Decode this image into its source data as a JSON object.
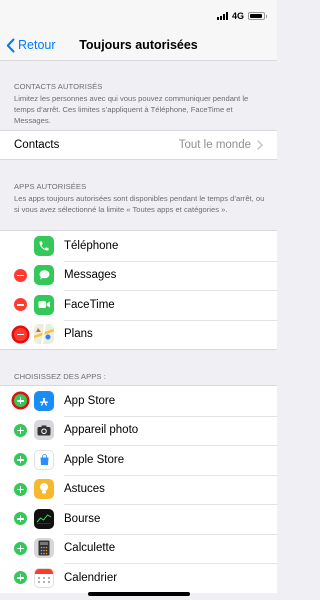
{
  "status_bar": {
    "network": "4G"
  },
  "nav": {
    "back_label": "Retour",
    "title": "Toujours autorisées"
  },
  "contacts_section": {
    "header": "CONTACTS AUTORISÉS",
    "description": "Limitez les personnes avec qui vous pouvez communiquer pendant le temps d’arrêt. Ces limites s’appliquent à Téléphone, FaceTime et Messages.",
    "row_label": "Contacts",
    "row_value": "Tout le monde"
  },
  "allowed_apps_section": {
    "header": "APPS AUTORISÉES",
    "description": "Les apps toujours autorisées sont disponibles pendant le temps d’arrêt, ou si vous avez sélectionné la limite « Toutes apps et catégories ».",
    "apps": [
      {
        "name": "Téléphone",
        "icon": "phone-icon",
        "removable": false
      },
      {
        "name": "Messages",
        "icon": "messages-icon",
        "removable": true
      },
      {
        "name": "FaceTime",
        "icon": "facetime-icon",
        "removable": true
      },
      {
        "name": "Plans",
        "icon": "maps-icon",
        "removable": true,
        "highlighted": true
      }
    ]
  },
  "choose_apps_section": {
    "header": "CHOISISSEZ DES APPS :",
    "apps": [
      {
        "name": "App Store",
        "icon": "app-store-icon",
        "highlighted": true
      },
      {
        "name": "Appareil photo",
        "icon": "camera-icon"
      },
      {
        "name": "Apple Store",
        "icon": "apple-store-icon"
      },
      {
        "name": "Astuces",
        "icon": "tips-icon"
      },
      {
        "name": "Bourse",
        "icon": "stocks-icon"
      },
      {
        "name": "Calculette",
        "icon": "calculator-icon"
      },
      {
        "name": "Calendrier",
        "icon": "calendar-icon"
      }
    ]
  },
  "colors": {
    "accent": "#007aff",
    "remove": "#ff3b30",
    "add": "#34c759",
    "highlight_ring": "#e01010"
  }
}
